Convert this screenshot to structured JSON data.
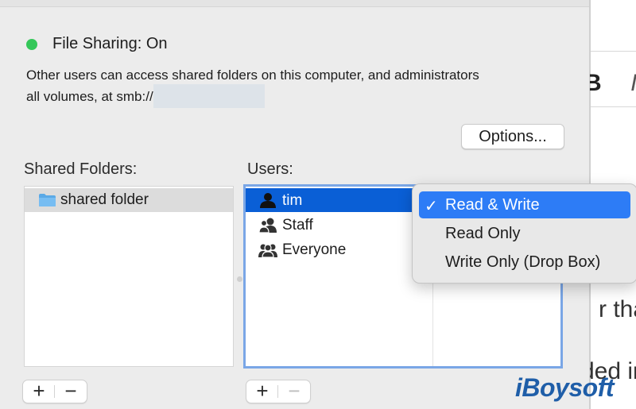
{
  "file_sharing": {
    "status_label": "File Sharing: On",
    "status_color": "#34c759",
    "description_line1": "Other users can access shared folders on this computer, and administrators",
    "description_line2": "all volumes, at smb://"
  },
  "options_button": "Options...",
  "shared_folders": {
    "heading": "Shared Folders:",
    "items": [
      {
        "name": "shared folder",
        "icon": "folder-icon"
      }
    ],
    "add_label": "+",
    "remove_label": "−"
  },
  "users": {
    "heading": "Users:",
    "items": [
      {
        "name": "tim",
        "icon": "person-icon",
        "selected": true
      },
      {
        "name": "Staff",
        "icon": "group-icon",
        "selected": false
      },
      {
        "name": "Everyone",
        "icon": "everyone-icon",
        "selected": false
      }
    ],
    "add_label": "+",
    "remove_label": "−",
    "selection_color": "#0a5fd6"
  },
  "permission_menu": {
    "items": [
      {
        "label": "Read & Write",
        "checked": true,
        "check": "✓"
      },
      {
        "label": "Read Only",
        "checked": false
      },
      {
        "label": "Write Only (Drop Box)",
        "checked": false
      }
    ],
    "highlight_color": "#2d7cf6"
  },
  "background_doc": {
    "bold_letter": "B",
    "italic_letter": "I",
    "text1": "r that",
    "text2": "ded in"
  },
  "watermark": "iBoysoft"
}
